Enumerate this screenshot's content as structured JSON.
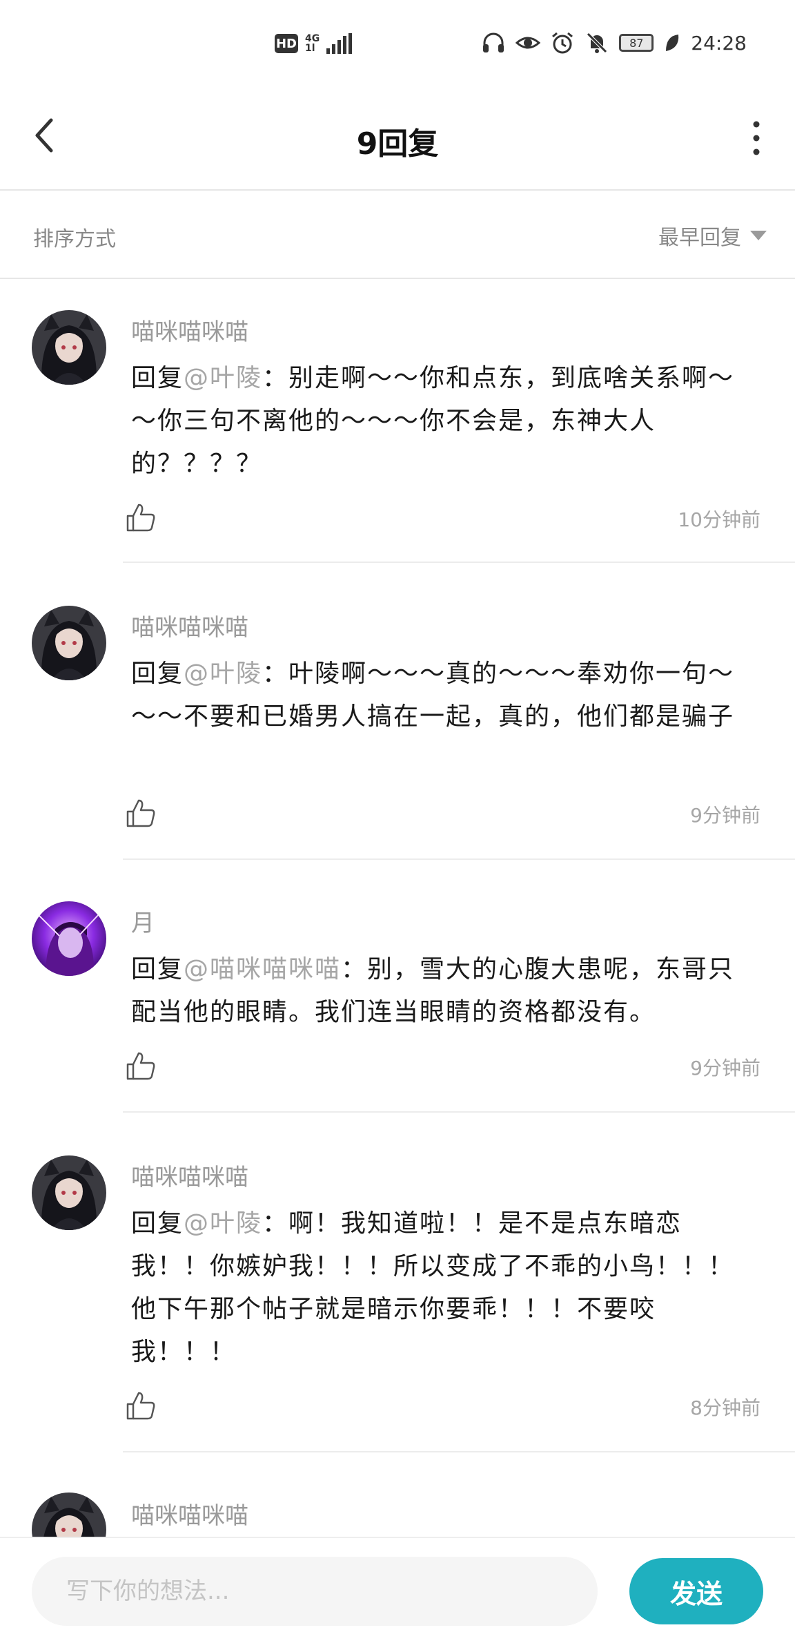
{
  "status_bar": {
    "hd_badge": "HD",
    "network_label_top": "4G",
    "network_label_bottom": "1l",
    "battery_level": "87",
    "time": "24:28"
  },
  "header": {
    "title": "9回复"
  },
  "sort": {
    "label": "排序方式",
    "value": "最早回复"
  },
  "comments": [
    {
      "username": "喵咪喵咪喵",
      "reply_prefix": "回复",
      "mention": "@叶陵",
      "text": "：别走啊～～你和点东，到底啥关系啊～～你三句不离他的～～～你不会是，东神大人的？？？？",
      "time": "10分钟前",
      "avatar": "dark-hair-anime-girl"
    },
    {
      "username": "喵咪喵咪喵",
      "reply_prefix": "回复",
      "mention": "@叶陵",
      "text": "：叶陵啊～～～真的～～～奉劝你一句～～～不要和已婚男人搞在一起，真的，他们都是骗子",
      "time": "9分钟前",
      "avatar": "dark-hair-anime-girl"
    },
    {
      "username": "月",
      "reply_prefix": "回复",
      "mention": "@喵咪喵咪喵",
      "text": "：别，雪大的心腹大患呢，东哥只配当他的眼睛。我们连当眼睛的资格都没有。",
      "time": "9分钟前",
      "avatar": "purple-glow-character"
    },
    {
      "username": "喵咪喵咪喵",
      "reply_prefix": "回复",
      "mention": "@叶陵",
      "text": "：啊！我知道啦！！是不是点东暗恋我！！你嫉妒我！！！所以变成了不乖的小鸟！！！他下午那个帖子就是暗示你要乖！！！不要咬我！！！",
      "time": "8分钟前",
      "avatar": "dark-hair-anime-girl"
    },
    {
      "username": "喵咪喵咪喵",
      "avatar": "dark-hair-anime-girl"
    }
  ],
  "composer": {
    "placeholder": "写下你的想法...",
    "send_label": "发送"
  },
  "colors": {
    "accent": "#1fb0bf",
    "muted_text": "#9a9a9a",
    "divider": "#e6e6e6"
  }
}
